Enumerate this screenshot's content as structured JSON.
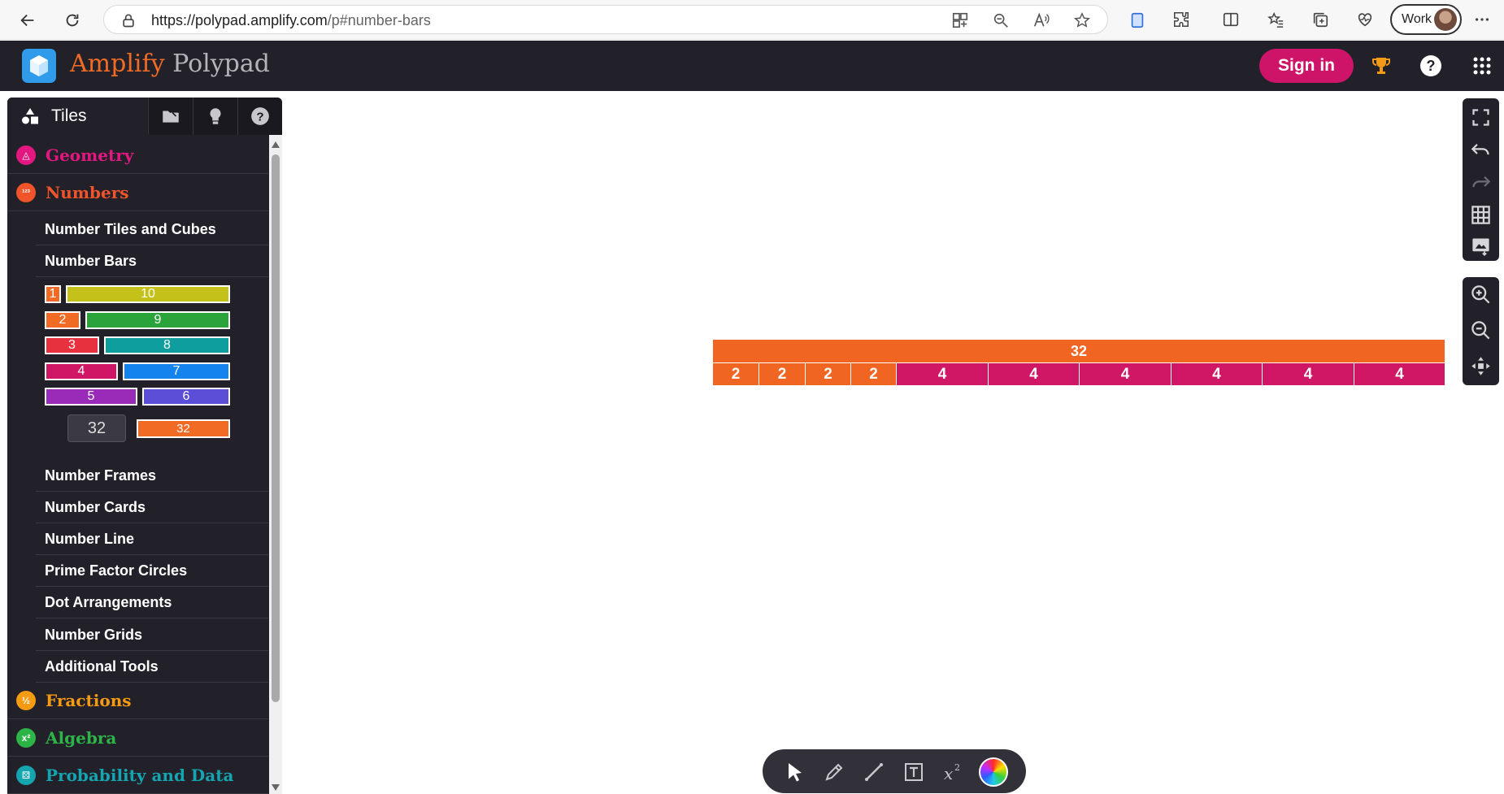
{
  "browser": {
    "url_host": "https://polypad.amplify.com",
    "url_path": "/p#number-bars",
    "profile_label": "Work"
  },
  "header": {
    "brand_primary": "Amplify",
    "brand_secondary": "Polypad",
    "signin_label": "Sign in",
    "brand_color": "#f26b25",
    "signin_color": "#cd1468"
  },
  "sidebar": {
    "tiles_label": "Tiles",
    "categories": [
      {
        "label": "Geometry",
        "color": "#e2177f"
      },
      {
        "label": "Numbers",
        "color": "#f0542a"
      },
      {
        "label": "Fractions",
        "color": "#f59b12"
      },
      {
        "label": "Algebra",
        "color": "#2db447"
      },
      {
        "label": "Probability and Data",
        "color": "#14a5b0"
      }
    ],
    "number_subitems": [
      "Number Tiles and Cubes",
      "Number Bars",
      "Number Frames",
      "Number Cards",
      "Number Line",
      "Prime Factor Circles",
      "Dot Arrangements",
      "Number Grids",
      "Additional Tools"
    ],
    "palette": {
      "rows": [
        [
          {
            "v": "1",
            "c": "#f26b25"
          },
          {
            "v": "10",
            "c": "#c5c11b"
          }
        ],
        [
          {
            "v": "2",
            "c": "#f26b25"
          },
          {
            "v": "9",
            "c": "#29a33a"
          }
        ],
        [
          {
            "v": "3",
            "c": "#e8313f"
          },
          {
            "v": "8",
            "c": "#0f9e9e"
          }
        ],
        [
          {
            "v": "4",
            "c": "#cf1766"
          },
          {
            "v": "7",
            "c": "#1583ee"
          }
        ],
        [
          {
            "v": "5",
            "c": "#9a2ab8"
          },
          {
            "v": "6",
            "c": "#5a4fd6"
          }
        ]
      ],
      "custom_input": "32",
      "custom_bar": "32"
    }
  },
  "canvas": {
    "total_bar": {
      "value": "32",
      "color": "#f06522"
    },
    "segments": [
      {
        "value": "2",
        "color": "#f06522"
      },
      {
        "value": "2",
        "color": "#f06522"
      },
      {
        "value": "2",
        "color": "#f06522"
      },
      {
        "value": "2",
        "color": "#f06522"
      },
      {
        "value": "4",
        "color": "#cf1766"
      },
      {
        "value": "4",
        "color": "#cf1766"
      },
      {
        "value": "4",
        "color": "#cf1766"
      },
      {
        "value": "4",
        "color": "#cf1766"
      },
      {
        "value": "4",
        "color": "#cf1766"
      },
      {
        "value": "4",
        "color": "#cf1766"
      }
    ]
  },
  "icons": {
    "right_toolbar": [
      "fullscreen-icon",
      "undo-icon",
      "redo-icon",
      "grid-icon",
      "export-image-icon",
      "zoom-in-icon",
      "zoom-out-icon",
      "pan-icon"
    ],
    "dock": [
      "select-icon",
      "pen-icon",
      "line-icon",
      "text-icon",
      "equation-icon",
      "color-wheel-icon"
    ]
  }
}
